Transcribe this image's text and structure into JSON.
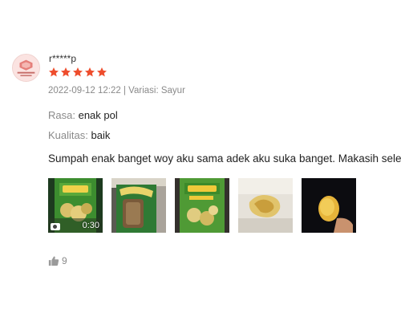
{
  "review": {
    "username": "r*****p",
    "rating": 5,
    "rating_max": 5,
    "meta": "2022-09-12 12:22 | Variasi: Sayur",
    "attributes": [
      {
        "label": "Rasa:",
        "value": "enak pol"
      },
      {
        "label": "Kualitas:",
        "value": "baik"
      }
    ],
    "comment": "Sumpah enak banget woy aku sama adek aku suka banget. Makasih seler",
    "media": [
      {
        "type": "video",
        "duration": "0:30"
      },
      {
        "type": "image"
      },
      {
        "type": "image"
      },
      {
        "type": "image"
      },
      {
        "type": "image"
      }
    ],
    "likes": "9"
  },
  "colors": {
    "star": "#ee4d2d",
    "muted_text": "#8a8a8a",
    "primary_text": "#222222"
  },
  "icons": {
    "rating": "star-icon",
    "like": "thumbs-up-icon",
    "video": "video-camera-icon"
  }
}
